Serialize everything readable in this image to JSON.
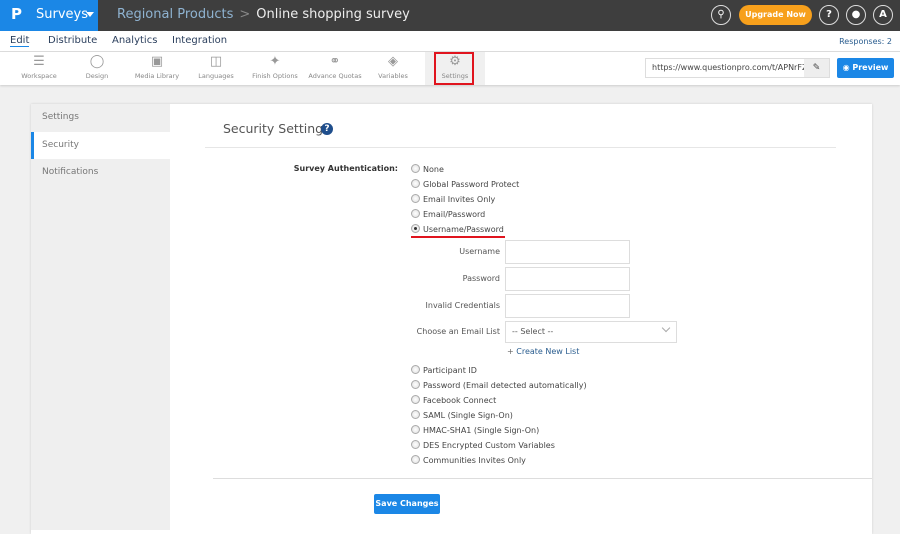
{
  "header": {
    "logo": "P",
    "app_name": "Surveys",
    "breadcrumb": [
      "Regional Products",
      "Online shopping survey"
    ],
    "upgrade_label": "Upgrade Now",
    "help_label": "?",
    "avatar_initial": "A",
    "accent_color": "#1b87e6",
    "upgrade_color": "#f7a01c"
  },
  "nav": {
    "tabs": [
      {
        "label": "Edit",
        "active": true
      },
      {
        "label": "Distribute"
      },
      {
        "label": "Analytics"
      },
      {
        "label": "Integration"
      }
    ],
    "responses": "Responses: 2"
  },
  "toolbar": {
    "items": [
      {
        "label": "Workspace",
        "icon": "list-icon"
      },
      {
        "label": "Design",
        "icon": "palette-icon"
      },
      {
        "label": "Media Library",
        "icon": "image-icon"
      },
      {
        "label": "Languages",
        "icon": "translate-icon"
      },
      {
        "label": "Finish Options",
        "icon": "magic-wand-icon"
      },
      {
        "label": "Advance Quotas",
        "icon": "link-chain-icon"
      },
      {
        "label": "Variables",
        "icon": "tag-icon"
      },
      {
        "label": "Settings",
        "icon": "gear-icon",
        "active": true
      }
    ],
    "url": "https://www.questionpro.com/t/APNrFZ",
    "preview_label": "Preview"
  },
  "sidebar": {
    "items": [
      {
        "label": "Settings"
      },
      {
        "label": "Security",
        "active": true
      },
      {
        "label": "Notifications"
      }
    ]
  },
  "main": {
    "title": "Security Settings",
    "auth_label": "Survey Authentication:",
    "options_top": [
      "None",
      "Global Password Protect",
      "Email Invites Only",
      "Email/Password",
      "Username/Password"
    ],
    "selected": "Username/Password",
    "fields": {
      "username_label": "Username",
      "username_value": "",
      "password_label": "Password",
      "password_value": "",
      "invalid_label": "Invalid Credentials",
      "invalid_value": "",
      "email_list_label": "Choose an Email List",
      "email_list_value": "-- Select --",
      "create_list": "Create New List"
    },
    "options_bottom": [
      "Participant ID",
      "Password (Email detected automatically)",
      "Facebook Connect",
      "SAML (Single Sign-On)",
      "HMAC-SHA1 (Single Sign-On)",
      "DES Encrypted Custom Variables",
      "Communities Invites Only"
    ],
    "save_label": "Save Changes"
  }
}
